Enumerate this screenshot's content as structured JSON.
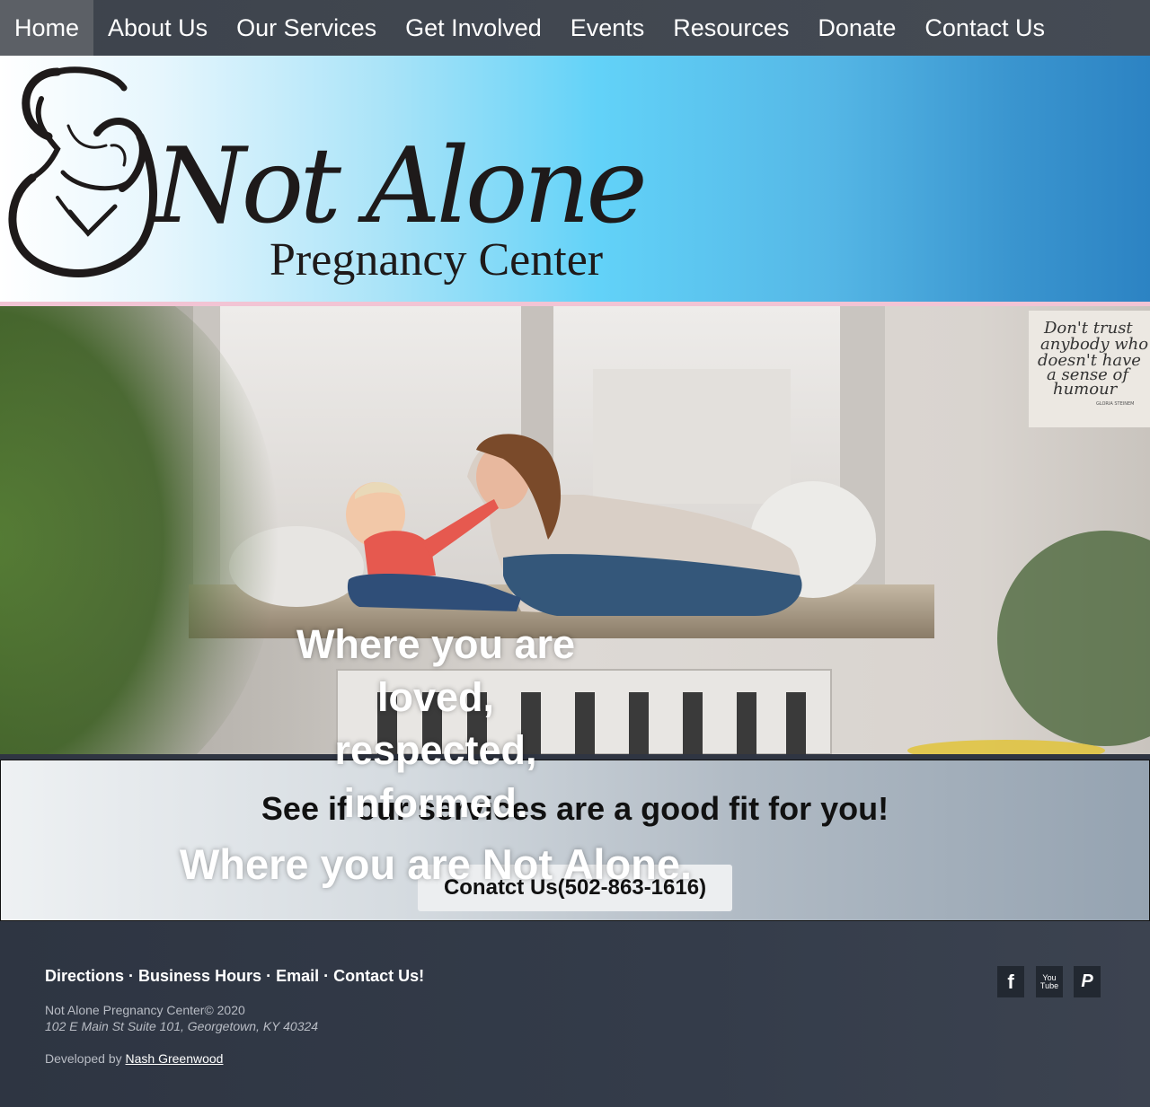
{
  "nav": {
    "items": [
      {
        "label": "Home",
        "active": true
      },
      {
        "label": "About Us"
      },
      {
        "label": "Our Services"
      },
      {
        "label": "Get Involved"
      },
      {
        "label": "Events"
      },
      {
        "label": "Resources"
      },
      {
        "label": "Donate"
      },
      {
        "label": "Contact Us"
      }
    ]
  },
  "header": {
    "logo_title": "Not Alone",
    "logo_subtitle": "Pregnancy Center"
  },
  "hero": {
    "tagline_lines": [
      "Where you are",
      "loved,",
      "respected,",
      "informed."
    ],
    "tagline_big": "Where you are Not Alone.",
    "poster_text": [
      "Don't trust",
      "anybody who",
      "doesn't have",
      "a sense of",
      "humour"
    ],
    "poster_author": "GLORIA STEINEM"
  },
  "cta": {
    "title": "See if our services are a good fit for you!",
    "button_label": "Conatct Us(502-863-1616)"
  },
  "footer": {
    "links": [
      "Directions",
      "Business Hours",
      "Email",
      "Contact Us!"
    ],
    "separator": "·",
    "copyright": "Not Alone Pregnancy Center© 2020",
    "address": "102 E Main St Suite 101, Georgetown, KY 40324",
    "developed_by_prefix": "Developed by ",
    "developer": "Nash Greenwood",
    "social": [
      {
        "name": "facebook-icon",
        "glyph": "f"
      },
      {
        "name": "youtube-icon",
        "glyph": "You\nTube"
      },
      {
        "name": "paypal-icon",
        "glyph": "P"
      }
    ]
  }
}
